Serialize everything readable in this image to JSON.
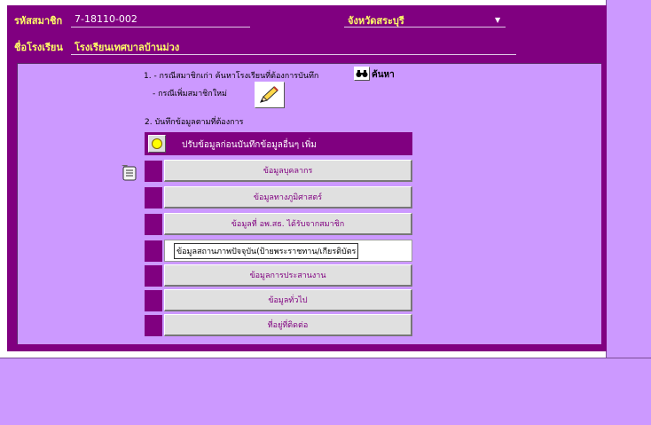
{
  "header": {
    "member_id_label": "รหัสสมาชิก",
    "member_id_value": "7-18110-002",
    "province_label": "จังหวัดสระบุรี",
    "school_label": "ชื่อโรงเรียน",
    "school_value": "โรงเรียนเทศบาลบ้านม่วง"
  },
  "instructions": {
    "step1_old_member": "1. - กรณีสมาชิกเก่า ค้นหาโรงเรียนที่ต้องการบันทึก",
    "search_label": "ค้นหา",
    "step1_new_member": "- กรณีเพิ่มสมาชิกใหม่",
    "step2": "2. บันทึกข้อมูลตามที่ต้องการ"
  },
  "panel": {
    "header_title": "ปรับข้อมูลก่อนบันทึกข้อมูลอื่นๆ เพิ่ม",
    "rows": [
      {
        "label": "ข้อมูลบุคลากร"
      },
      {
        "label": "ข้อมูลทางภูมิศาสตร์"
      },
      {
        "label": "ข้อมูลที่ อพ.สธ. ได้รับจากสมาชิก"
      },
      {
        "label": "ข้อมูลสถานภาพปัจจุบัน(ป้ายพระราชทาน/เกียรติบัตร"
      },
      {
        "label": "ข้อมูลการประสานงาน"
      },
      {
        "label": "ข้อมูลทั่วไป"
      },
      {
        "label": "ที่อยู่ที่ติดต่อ"
      }
    ]
  },
  "icons": {
    "search": "binoculars-icon",
    "new_member": "pencil-icon",
    "pointer": "hand-pointer-icon",
    "status": "smiley-icon"
  },
  "colors": {
    "panel_purple": "#800080",
    "lavender": "#cc99ff",
    "header_label_yellow": "#ffff66"
  }
}
